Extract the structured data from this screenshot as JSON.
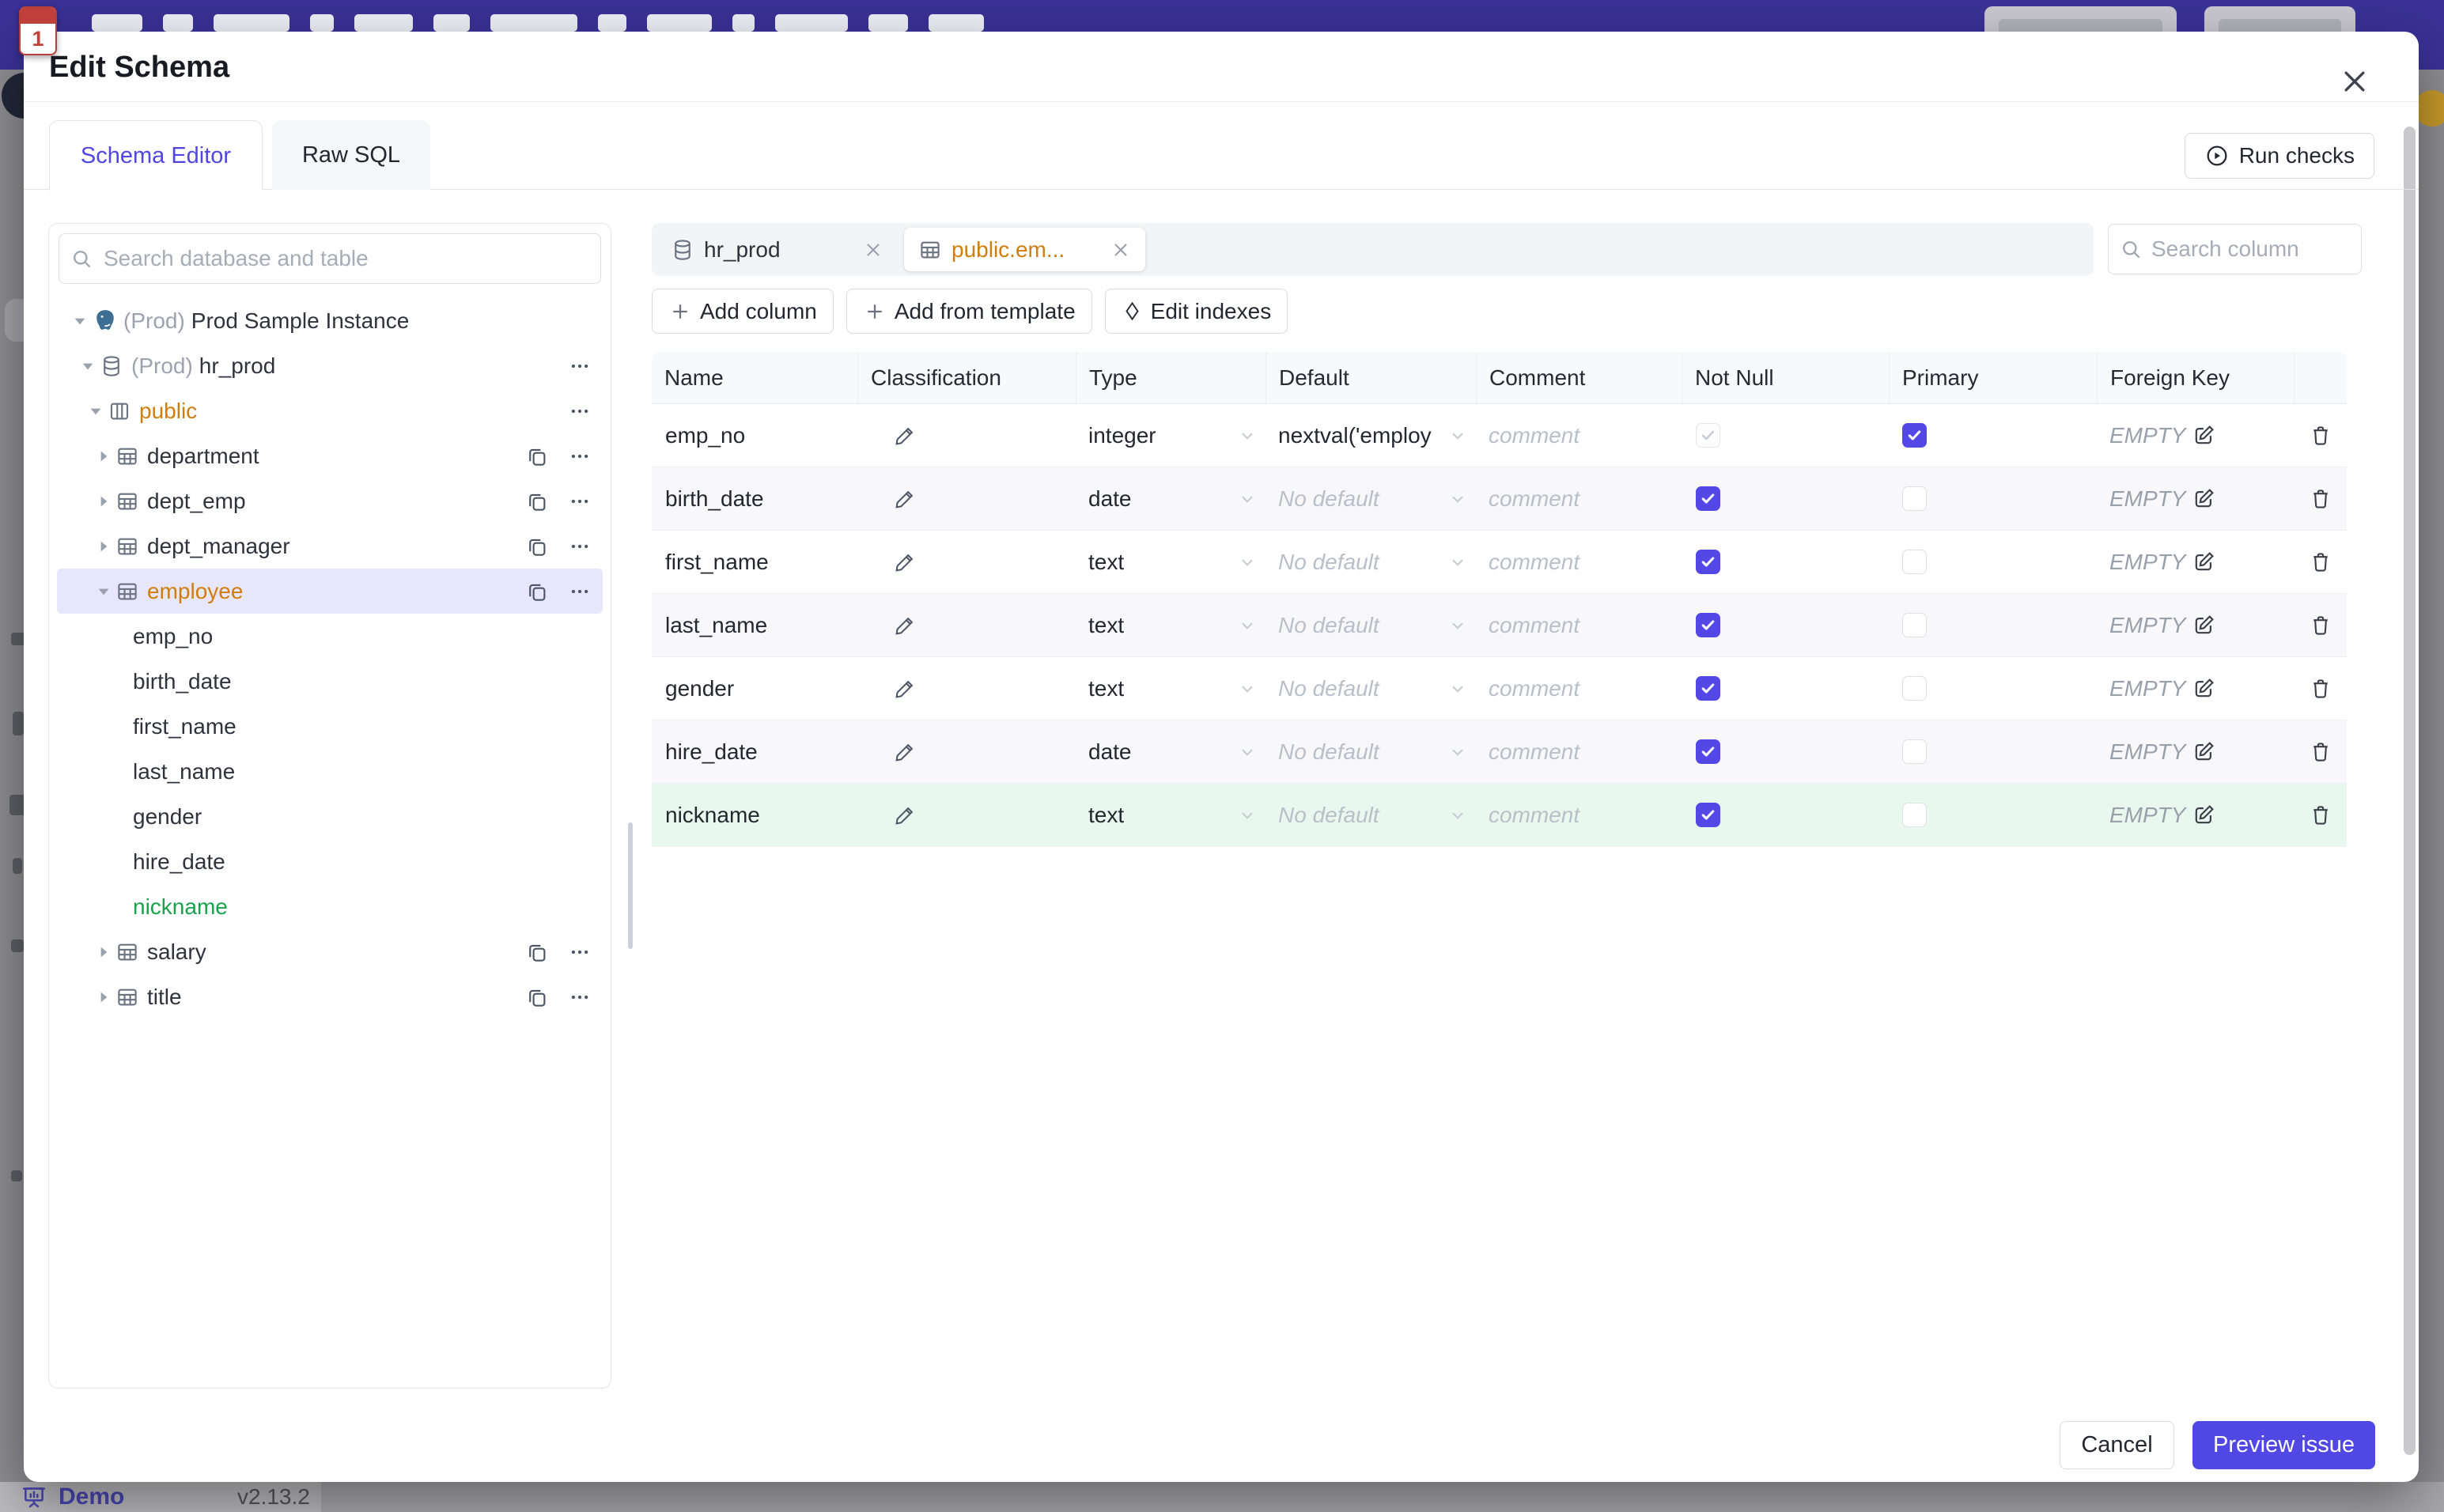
{
  "colors": {
    "accent": "#5147e5",
    "modified_text": "#d07d0a",
    "added_text": "#16a34a",
    "added_row_bg": "#e9f8ee",
    "selected_row_bg": "#e8e6fb",
    "topbar": "#3a3297"
  },
  "backdrop": {
    "footer_app": "Demo",
    "footer_version": "v2.13.2",
    "calendar_badge": "1"
  },
  "dialog": {
    "title": "Edit Schema",
    "tabs": [
      {
        "label": "Schema Editor",
        "active": true
      },
      {
        "label": "Raw SQL",
        "active": false
      }
    ],
    "run_checks": "Run checks",
    "footer": {
      "cancel": "Cancel",
      "submit": "Preview issue"
    }
  },
  "sidebar": {
    "search_placeholder": "Search database and table",
    "tree": [
      {
        "type": "instance",
        "prefix": "(Prod)",
        "label": "Prod Sample Instance",
        "expanded": true
      },
      {
        "type": "database",
        "prefix": "(Prod)",
        "label": "hr_prod",
        "expanded": true,
        "menu": true
      },
      {
        "type": "schema",
        "label": "public",
        "expanded": true,
        "menu": true,
        "state": "modified"
      },
      {
        "type": "table",
        "label": "department",
        "copy": true,
        "menu": true
      },
      {
        "type": "table",
        "label": "dept_emp",
        "copy": true,
        "menu": true
      },
      {
        "type": "table",
        "label": "dept_manager",
        "copy": true,
        "menu": true
      },
      {
        "type": "table",
        "label": "employee",
        "expanded": true,
        "copy": true,
        "menu": true,
        "state": "modified",
        "selected": true
      },
      {
        "type": "column",
        "label": "emp_no"
      },
      {
        "type": "column",
        "label": "birth_date"
      },
      {
        "type": "column",
        "label": "first_name"
      },
      {
        "type": "column",
        "label": "last_name"
      },
      {
        "type": "column",
        "label": "gender"
      },
      {
        "type": "column",
        "label": "hire_date"
      },
      {
        "type": "column",
        "label": "nickname",
        "state": "added"
      },
      {
        "type": "table",
        "label": "salary",
        "copy": true,
        "menu": true
      },
      {
        "type": "table",
        "label": "title",
        "copy": true,
        "menu": true
      }
    ]
  },
  "editor": {
    "tabs": [
      {
        "label": "hr_prod",
        "icon": "database",
        "active": false
      },
      {
        "label": "public.em...",
        "icon": "table",
        "active": true,
        "modified": true
      }
    ],
    "search_placeholder": "Search column",
    "toolbar": [
      {
        "label": "Add column",
        "icon": "plus"
      },
      {
        "label": "Add from template",
        "icon": "plus"
      },
      {
        "label": "Edit indexes",
        "icon": "diamond"
      }
    ],
    "columns_table": {
      "headers": [
        "Name",
        "Classification",
        "Type",
        "Default",
        "Comment",
        "Not Null",
        "Primary",
        "Foreign Key",
        ""
      ],
      "comment_placeholder": "comment",
      "no_default_placeholder": "No default",
      "fk_empty": "EMPTY",
      "rows": [
        {
          "name": "emp_no",
          "type": "integer",
          "default": "nextval('employ",
          "not_null": "checked_disabled",
          "primary": true,
          "highlight": null
        },
        {
          "name": "birth_date",
          "type": "date",
          "default": null,
          "not_null": "checked",
          "primary": false,
          "highlight": null
        },
        {
          "name": "first_name",
          "type": "text",
          "default": null,
          "not_null": "checked",
          "primary": false,
          "highlight": null
        },
        {
          "name": "last_name",
          "type": "text",
          "default": null,
          "not_null": "checked",
          "primary": false,
          "highlight": null
        },
        {
          "name": "gender",
          "type": "text",
          "default": null,
          "not_null": "checked",
          "primary": false,
          "highlight": null
        },
        {
          "name": "hire_date",
          "type": "date",
          "default": null,
          "not_null": "checked",
          "primary": false,
          "highlight": null
        },
        {
          "name": "nickname",
          "type": "text",
          "default": null,
          "not_null": "checked",
          "primary": false,
          "highlight": "added"
        }
      ]
    }
  }
}
